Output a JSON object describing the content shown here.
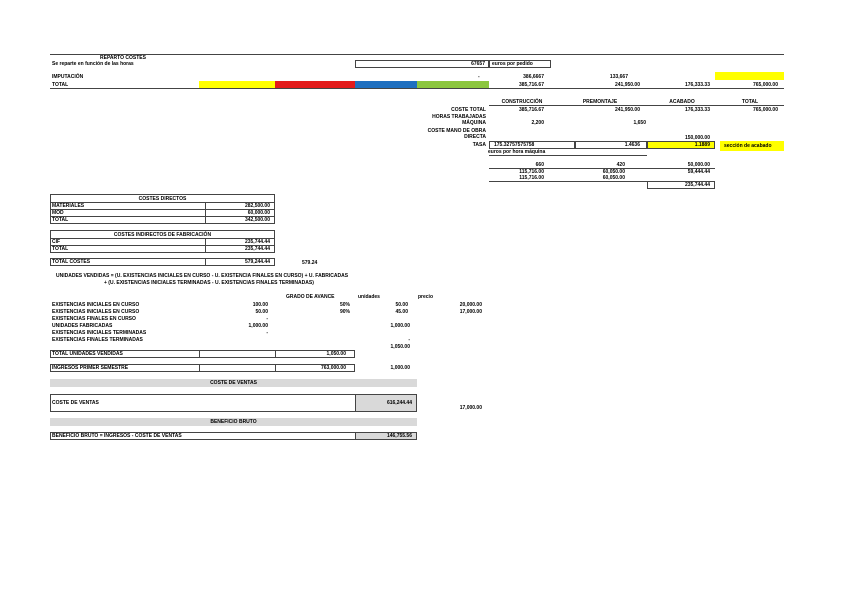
{
  "colors": {
    "yellow": "#ffff00",
    "red": "#e31b1b",
    "blue": "#1f6fbf",
    "green": "#8cc63e",
    "gray": "#d9d9d9"
  },
  "reparto": {
    "title": "REPARTO COSTES",
    "subtitle": "Se reparte en función de las horas",
    "box_value": "67657",
    "box_label": "euros por pedido",
    "imputacion_label": "IMPUTACIÓN",
    "dash": "-",
    "imp_v1": "386,6667",
    "imp_v2": "133,667",
    "total_label": "TOTAL",
    "total_v1": "385,716.67",
    "total_v2": "241,950.00",
    "total_v3": "176,333.33",
    "total_v4": "765,000.00"
  },
  "sections": {
    "headers": [
      "CONSTRUCCIÓN",
      "PREMONTAJE",
      "ACABADO",
      "TOTAL"
    ],
    "coste_total_label": "COSTE TOTAL",
    "coste_total": [
      "385,716.67",
      "241,950.00",
      "176,333.33",
      "765,000.00"
    ],
    "horas_label_1": "HORAS TRABAJADAS",
    "horas_label_2": "MÁQUINA",
    "horas": [
      "2,200",
      "",
      "1,650"
    ],
    "mano_label_1": "COSTE MANO DE OBRA",
    "mano_label_2": "DIRECTA",
    "mano_acabado": "150,000.00",
    "tasa_label": "TASA",
    "tasa_v1": "175.32757575758",
    "tasa_v2": "1.4636",
    "tasa_v3": "1.1889",
    "tasa_note": "sección de acabado",
    "tasa_sub": "euros por hora máquina",
    "calc_r1": [
      "660",
      "420",
      "50,000.00"
    ],
    "calc_r2": [
      "115,716.00",
      "60,050.00",
      "59,444.44"
    ],
    "calc_r3": [
      "115,716.00",
      "60,050.00"
    ],
    "calc_total": "235,744.44"
  },
  "costes_directos": {
    "title": "COSTES DIRECTOS",
    "rows": [
      {
        "label": "MATERIALES",
        "value": "282,500.00"
      },
      {
        "label": "MOD",
        "value": "60,000.00"
      },
      {
        "label": "TOTAL",
        "value": "342,500.00"
      }
    ]
  },
  "costes_indirectos": {
    "title": "COSTES INDIRECTOS DE FABRICACIÓN",
    "rows": [
      {
        "label": "CIF",
        "value": "235,744.44"
      },
      {
        "label": "TOTAL",
        "value": "235,744.44"
      }
    ]
  },
  "total_costes": {
    "label": "TOTAL COSTES",
    "value": "579,244.44",
    "side": "579.24"
  },
  "formula": {
    "line1": "UNIDADES VENDIDAS = (U. EXISTENCIAS INICIALES EN CURSO - U. EXISTENCIA FINALES EN CURSO) + U. FABRICADAS",
    "line2": "+ (U. EXISTENCIAS INICIALES TERMINADAS - U. EXISTENCIAS FINALES TERMINADAS)"
  },
  "unidades": {
    "col_grado": "GRADO DE AVANCE",
    "col_unidades": "unidades",
    "col_precio": "precio",
    "rows": [
      {
        "label": "EXISTENCIAS INICIALES EN CURSO",
        "a": "100.00",
        "b": "50%",
        "c": "50.00",
        "d": "20,000.00"
      },
      {
        "label": "EXISTENCIAS INICIALES EN CURSO",
        "a": "50.00",
        "b": "90%",
        "c": "45.00",
        "d": "17,000.00"
      },
      {
        "label": "EXISTENCIAS FINALES EN CURSO",
        "a": "-",
        "b": "",
        "c": "",
        "d": ""
      },
      {
        "label": "UNIDADES FABRICADAS",
        "a": "1,000.00",
        "b": "",
        "c": "1,000.00",
        "d": ""
      },
      {
        "label": "EXISTENCIAS INICIALES TERMINADAS",
        "a": "-",
        "b": "",
        "c": "",
        "d": ""
      },
      {
        "label": "EXISTENCIAS FINALES TERMINADAS",
        "a": "",
        "b": "",
        "c": "-",
        "d": ""
      }
    ],
    "after_c": "1,050.00",
    "total_label": "TOTAL UNIDADES VENDIDAS",
    "total_value": "1,050.00",
    "ingresos_label": "INGRESOS PRIMER SEMESTRE",
    "ingresos_value": "763,000.00",
    "ingresos_side": "1,000.00"
  },
  "coste_ventas": {
    "title": "COSTE DE VENTAS",
    "label": "COSTE DE VENTAS",
    "value": "616,244.44",
    "side": "17,000.00"
  },
  "beneficio": {
    "title": "BENEFICIO BRUTO",
    "label": "BENEFICIO BRUTO = INGRESOS - COSTE DE VENTAS",
    "value": "146,755.56"
  }
}
